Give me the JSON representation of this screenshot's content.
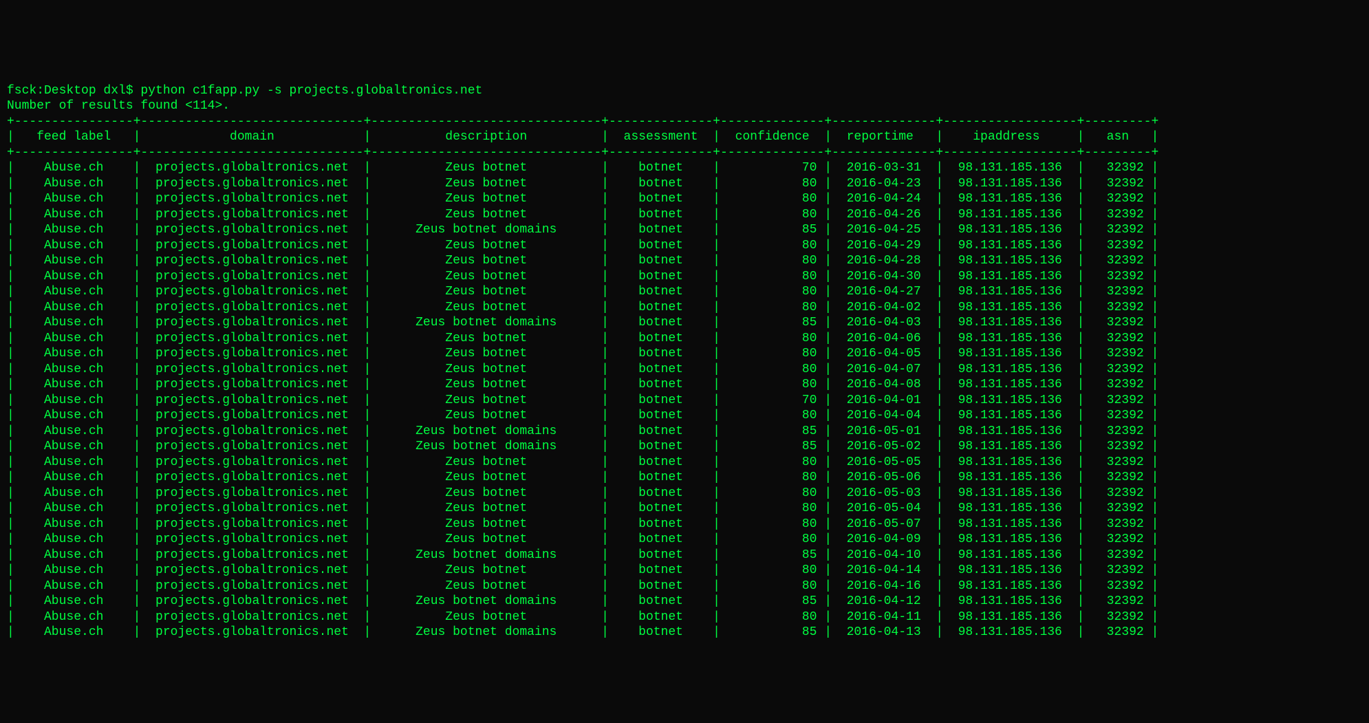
{
  "prompt": "fsck:Desktop dxl$ python c1fapp.py -s projects.globaltronics.net",
  "summary_prefix": "Number of results found <",
  "summary_count": "114",
  "summary_suffix": ">.",
  "columns": [
    {
      "key": "feed",
      "label": "feed label",
      "width": 14,
      "align": "center"
    },
    {
      "key": "domain",
      "label": "domain",
      "width": 28,
      "align": "center"
    },
    {
      "key": "description",
      "label": "description",
      "width": 29,
      "align": "center"
    },
    {
      "key": "assessment",
      "label": "assessment",
      "width": 12,
      "align": "center"
    },
    {
      "key": "confidence",
      "label": "confidence",
      "width": 12,
      "align": "right"
    },
    {
      "key": "reportime",
      "label": "reportime",
      "width": 12,
      "align": "center"
    },
    {
      "key": "ipaddress",
      "label": "ipaddress",
      "width": 16,
      "align": "center"
    },
    {
      "key": "asn",
      "label": "asn",
      "width": 7,
      "align": "right"
    }
  ],
  "rows": [
    {
      "feed": "Abuse.ch",
      "domain": "projects.globaltronics.net",
      "description": "Zeus botnet",
      "assessment": "botnet",
      "confidence": "70",
      "reportime": "2016-03-31",
      "ipaddress": "98.131.185.136",
      "asn": "32392"
    },
    {
      "feed": "Abuse.ch",
      "domain": "projects.globaltronics.net",
      "description": "Zeus botnet",
      "assessment": "botnet",
      "confidence": "80",
      "reportime": "2016-04-23",
      "ipaddress": "98.131.185.136",
      "asn": "32392"
    },
    {
      "feed": "Abuse.ch",
      "domain": "projects.globaltronics.net",
      "description": "Zeus botnet",
      "assessment": "botnet",
      "confidence": "80",
      "reportime": "2016-04-24",
      "ipaddress": "98.131.185.136",
      "asn": "32392"
    },
    {
      "feed": "Abuse.ch",
      "domain": "projects.globaltronics.net",
      "description": "Zeus botnet",
      "assessment": "botnet",
      "confidence": "80",
      "reportime": "2016-04-26",
      "ipaddress": "98.131.185.136",
      "asn": "32392"
    },
    {
      "feed": "Abuse.ch",
      "domain": "projects.globaltronics.net",
      "description": "Zeus botnet domains",
      "assessment": "botnet",
      "confidence": "85",
      "reportime": "2016-04-25",
      "ipaddress": "98.131.185.136",
      "asn": "32392"
    },
    {
      "feed": "Abuse.ch",
      "domain": "projects.globaltronics.net",
      "description": "Zeus botnet",
      "assessment": "botnet",
      "confidence": "80",
      "reportime": "2016-04-29",
      "ipaddress": "98.131.185.136",
      "asn": "32392"
    },
    {
      "feed": "Abuse.ch",
      "domain": "projects.globaltronics.net",
      "description": "Zeus botnet",
      "assessment": "botnet",
      "confidence": "80",
      "reportime": "2016-04-28",
      "ipaddress": "98.131.185.136",
      "asn": "32392"
    },
    {
      "feed": "Abuse.ch",
      "domain": "projects.globaltronics.net",
      "description": "Zeus botnet",
      "assessment": "botnet",
      "confidence": "80",
      "reportime": "2016-04-30",
      "ipaddress": "98.131.185.136",
      "asn": "32392"
    },
    {
      "feed": "Abuse.ch",
      "domain": "projects.globaltronics.net",
      "description": "Zeus botnet",
      "assessment": "botnet",
      "confidence": "80",
      "reportime": "2016-04-27",
      "ipaddress": "98.131.185.136",
      "asn": "32392"
    },
    {
      "feed": "Abuse.ch",
      "domain": "projects.globaltronics.net",
      "description": "Zeus botnet",
      "assessment": "botnet",
      "confidence": "80",
      "reportime": "2016-04-02",
      "ipaddress": "98.131.185.136",
      "asn": "32392"
    },
    {
      "feed": "Abuse.ch",
      "domain": "projects.globaltronics.net",
      "description": "Zeus botnet domains",
      "assessment": "botnet",
      "confidence": "85",
      "reportime": "2016-04-03",
      "ipaddress": "98.131.185.136",
      "asn": "32392"
    },
    {
      "feed": "Abuse.ch",
      "domain": "projects.globaltronics.net",
      "description": "Zeus botnet",
      "assessment": "botnet",
      "confidence": "80",
      "reportime": "2016-04-06",
      "ipaddress": "98.131.185.136",
      "asn": "32392"
    },
    {
      "feed": "Abuse.ch",
      "domain": "projects.globaltronics.net",
      "description": "Zeus botnet",
      "assessment": "botnet",
      "confidence": "80",
      "reportime": "2016-04-05",
      "ipaddress": "98.131.185.136",
      "asn": "32392"
    },
    {
      "feed": "Abuse.ch",
      "domain": "projects.globaltronics.net",
      "description": "Zeus botnet",
      "assessment": "botnet",
      "confidence": "80",
      "reportime": "2016-04-07",
      "ipaddress": "98.131.185.136",
      "asn": "32392"
    },
    {
      "feed": "Abuse.ch",
      "domain": "projects.globaltronics.net",
      "description": "Zeus botnet",
      "assessment": "botnet",
      "confidence": "80",
      "reportime": "2016-04-08",
      "ipaddress": "98.131.185.136",
      "asn": "32392"
    },
    {
      "feed": "Abuse.ch",
      "domain": "projects.globaltronics.net",
      "description": "Zeus botnet",
      "assessment": "botnet",
      "confidence": "70",
      "reportime": "2016-04-01",
      "ipaddress": "98.131.185.136",
      "asn": "32392"
    },
    {
      "feed": "Abuse.ch",
      "domain": "projects.globaltronics.net",
      "description": "Zeus botnet",
      "assessment": "botnet",
      "confidence": "80",
      "reportime": "2016-04-04",
      "ipaddress": "98.131.185.136",
      "asn": "32392"
    },
    {
      "feed": "Abuse.ch",
      "domain": "projects.globaltronics.net",
      "description": "Zeus botnet domains",
      "assessment": "botnet",
      "confidence": "85",
      "reportime": "2016-05-01",
      "ipaddress": "98.131.185.136",
      "asn": "32392"
    },
    {
      "feed": "Abuse.ch",
      "domain": "projects.globaltronics.net",
      "description": "Zeus botnet domains",
      "assessment": "botnet",
      "confidence": "85",
      "reportime": "2016-05-02",
      "ipaddress": "98.131.185.136",
      "asn": "32392"
    },
    {
      "feed": "Abuse.ch",
      "domain": "projects.globaltronics.net",
      "description": "Zeus botnet",
      "assessment": "botnet",
      "confidence": "80",
      "reportime": "2016-05-05",
      "ipaddress": "98.131.185.136",
      "asn": "32392"
    },
    {
      "feed": "Abuse.ch",
      "domain": "projects.globaltronics.net",
      "description": "Zeus botnet",
      "assessment": "botnet",
      "confidence": "80",
      "reportime": "2016-05-06",
      "ipaddress": "98.131.185.136",
      "asn": "32392"
    },
    {
      "feed": "Abuse.ch",
      "domain": "projects.globaltronics.net",
      "description": "Zeus botnet",
      "assessment": "botnet",
      "confidence": "80",
      "reportime": "2016-05-03",
      "ipaddress": "98.131.185.136",
      "asn": "32392"
    },
    {
      "feed": "Abuse.ch",
      "domain": "projects.globaltronics.net",
      "description": "Zeus botnet",
      "assessment": "botnet",
      "confidence": "80",
      "reportime": "2016-05-04",
      "ipaddress": "98.131.185.136",
      "asn": "32392"
    },
    {
      "feed": "Abuse.ch",
      "domain": "projects.globaltronics.net",
      "description": "Zeus botnet",
      "assessment": "botnet",
      "confidence": "80",
      "reportime": "2016-05-07",
      "ipaddress": "98.131.185.136",
      "asn": "32392"
    },
    {
      "feed": "Abuse.ch",
      "domain": "projects.globaltronics.net",
      "description": "Zeus botnet",
      "assessment": "botnet",
      "confidence": "80",
      "reportime": "2016-04-09",
      "ipaddress": "98.131.185.136",
      "asn": "32392"
    },
    {
      "feed": "Abuse.ch",
      "domain": "projects.globaltronics.net",
      "description": "Zeus botnet domains",
      "assessment": "botnet",
      "confidence": "85",
      "reportime": "2016-04-10",
      "ipaddress": "98.131.185.136",
      "asn": "32392"
    },
    {
      "feed": "Abuse.ch",
      "domain": "projects.globaltronics.net",
      "description": "Zeus botnet",
      "assessment": "botnet",
      "confidence": "80",
      "reportime": "2016-04-14",
      "ipaddress": "98.131.185.136",
      "asn": "32392"
    },
    {
      "feed": "Abuse.ch",
      "domain": "projects.globaltronics.net",
      "description": "Zeus botnet",
      "assessment": "botnet",
      "confidence": "80",
      "reportime": "2016-04-16",
      "ipaddress": "98.131.185.136",
      "asn": "32392"
    },
    {
      "feed": "Abuse.ch",
      "domain": "projects.globaltronics.net",
      "description": "Zeus botnet domains",
      "assessment": "botnet",
      "confidence": "85",
      "reportime": "2016-04-12",
      "ipaddress": "98.131.185.136",
      "asn": "32392"
    },
    {
      "feed": "Abuse.ch",
      "domain": "projects.globaltronics.net",
      "description": "Zeus botnet",
      "assessment": "botnet",
      "confidence": "80",
      "reportime": "2016-04-11",
      "ipaddress": "98.131.185.136",
      "asn": "32392"
    },
    {
      "feed": "Abuse.ch",
      "domain": "projects.globaltronics.net",
      "description": "Zeus botnet domains",
      "assessment": "botnet",
      "confidence": "85",
      "reportime": "2016-04-13",
      "ipaddress": "98.131.185.136",
      "asn": "32392"
    }
  ]
}
